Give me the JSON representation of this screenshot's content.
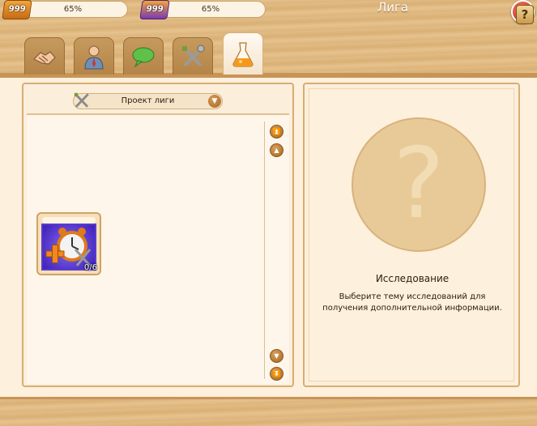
{
  "header": {
    "title": "Лига",
    "resources": [
      {
        "icon": "gold-badge-icon",
        "value": "999",
        "progress_label": "65%",
        "progress": 0.65
      },
      {
        "icon": "purple-badge-icon",
        "value": "999",
        "progress_label": "65%",
        "progress": 0.65
      }
    ],
    "tabs": [
      {
        "icon": "handshake-icon",
        "active": false
      },
      {
        "icon": "person-icon",
        "active": false
      },
      {
        "icon": "chat-bubble-icon",
        "active": false
      },
      {
        "icon": "crossed-tools-icon",
        "active": false
      },
      {
        "icon": "flask-icon",
        "active": true
      }
    ],
    "close_icon": "close-icon"
  },
  "left_panel": {
    "dropdown": {
      "label": "Проект лиги",
      "icon": "crossed-tools-icon"
    },
    "research_items": [
      {
        "icon": "alarm-clock-plus-icon",
        "count": "0/6"
      }
    ]
  },
  "right_panel": {
    "icon": "question-mark-icon",
    "title": "Исследование",
    "description": "Выберите тему исследований для получения дополнительной информации."
  },
  "footer": {
    "help_icon": "help-icon"
  },
  "colors": {
    "accent": "#c79458",
    "close": "#c3231a",
    "panel": "#fbeedb"
  }
}
